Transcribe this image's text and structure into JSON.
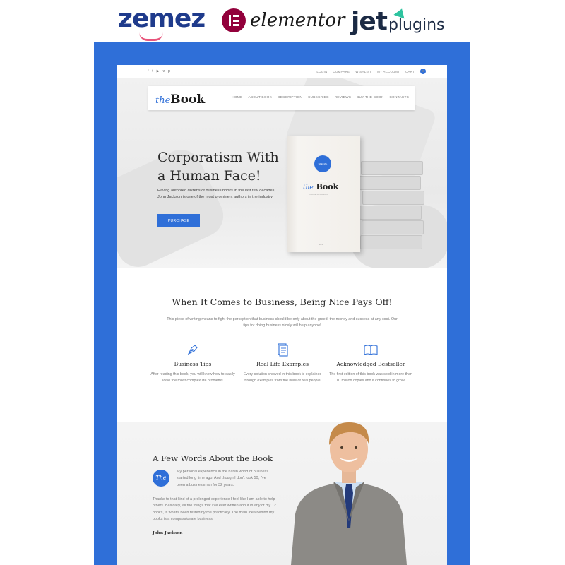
{
  "brands": {
    "zemez": "zemez",
    "elementor": "elementor",
    "jet": "jet",
    "plugins": "plugins"
  },
  "topbar": {
    "socials": [
      "f",
      "t",
      "▶",
      "v",
      "p"
    ],
    "menu": [
      "LOGIN",
      "COMPARE",
      "WISHLIST",
      "MY ACCOUNT"
    ],
    "cart_label": "CART",
    "cart_count": "0"
  },
  "nav": {
    "logo_the": "the",
    "logo_book": "Book",
    "links": [
      "HOME",
      "ABOUT BOOK",
      "DESCRIPTION",
      "SUBSCRIBE",
      "REVIEWS",
      "BUY THE BOOK",
      "CONTACTS"
    ]
  },
  "hero": {
    "title_line1": "Corporatism With",
    "title_line2": "a Human Face!",
    "text": "Having authored dozens of business books in the last few decades, John Jackson is one of the most prominent authors in the industry.",
    "button": "PURCHASE",
    "book_badge": "SPECIAL EDITION",
    "book_the": "the",
    "book_title": "Book",
    "book_sub": "JOHN JACKSON",
    "book_foot": "2017"
  },
  "features_section": {
    "title": "When It Comes to Business, Being Nice Pays Off!",
    "text": "This piece of writing means to fight the perception that business should be only about the greed, the money and success at any cost. Our tips for doing business nicely will help anyone!",
    "items": [
      {
        "icon": "pen-icon",
        "title": "Business Tips",
        "text": "After reading this book, you will know how to easily solve the most complex life problems."
      },
      {
        "icon": "document-icon",
        "title": "Real Life Examples",
        "text": "Every solution showed in this book is explained through examples from the lives of real people."
      },
      {
        "icon": "open-book-icon",
        "title": "Acknowledged Bestseller",
        "text": "The first edition of this book was sold in more than 10 million copies and it continues to grow."
      }
    ]
  },
  "about": {
    "title": "A Few Words About the Book",
    "badge": "The",
    "p1": "My personal experience in the harsh world of business started long time ago. And though I don't look 50, I've been a businessman for 32 years.",
    "p2": "Thanks to that kind of a prolonged experience I feel like I am able to help others. Basically, all the things that I've ever written about in any of my 12 books, is what's been tested by me practically. The main idea behind my books is a compassionate business.",
    "signature": "John Jackson"
  },
  "colors": {
    "accent": "#2f6fd8",
    "frame": "#2f6fd8"
  }
}
